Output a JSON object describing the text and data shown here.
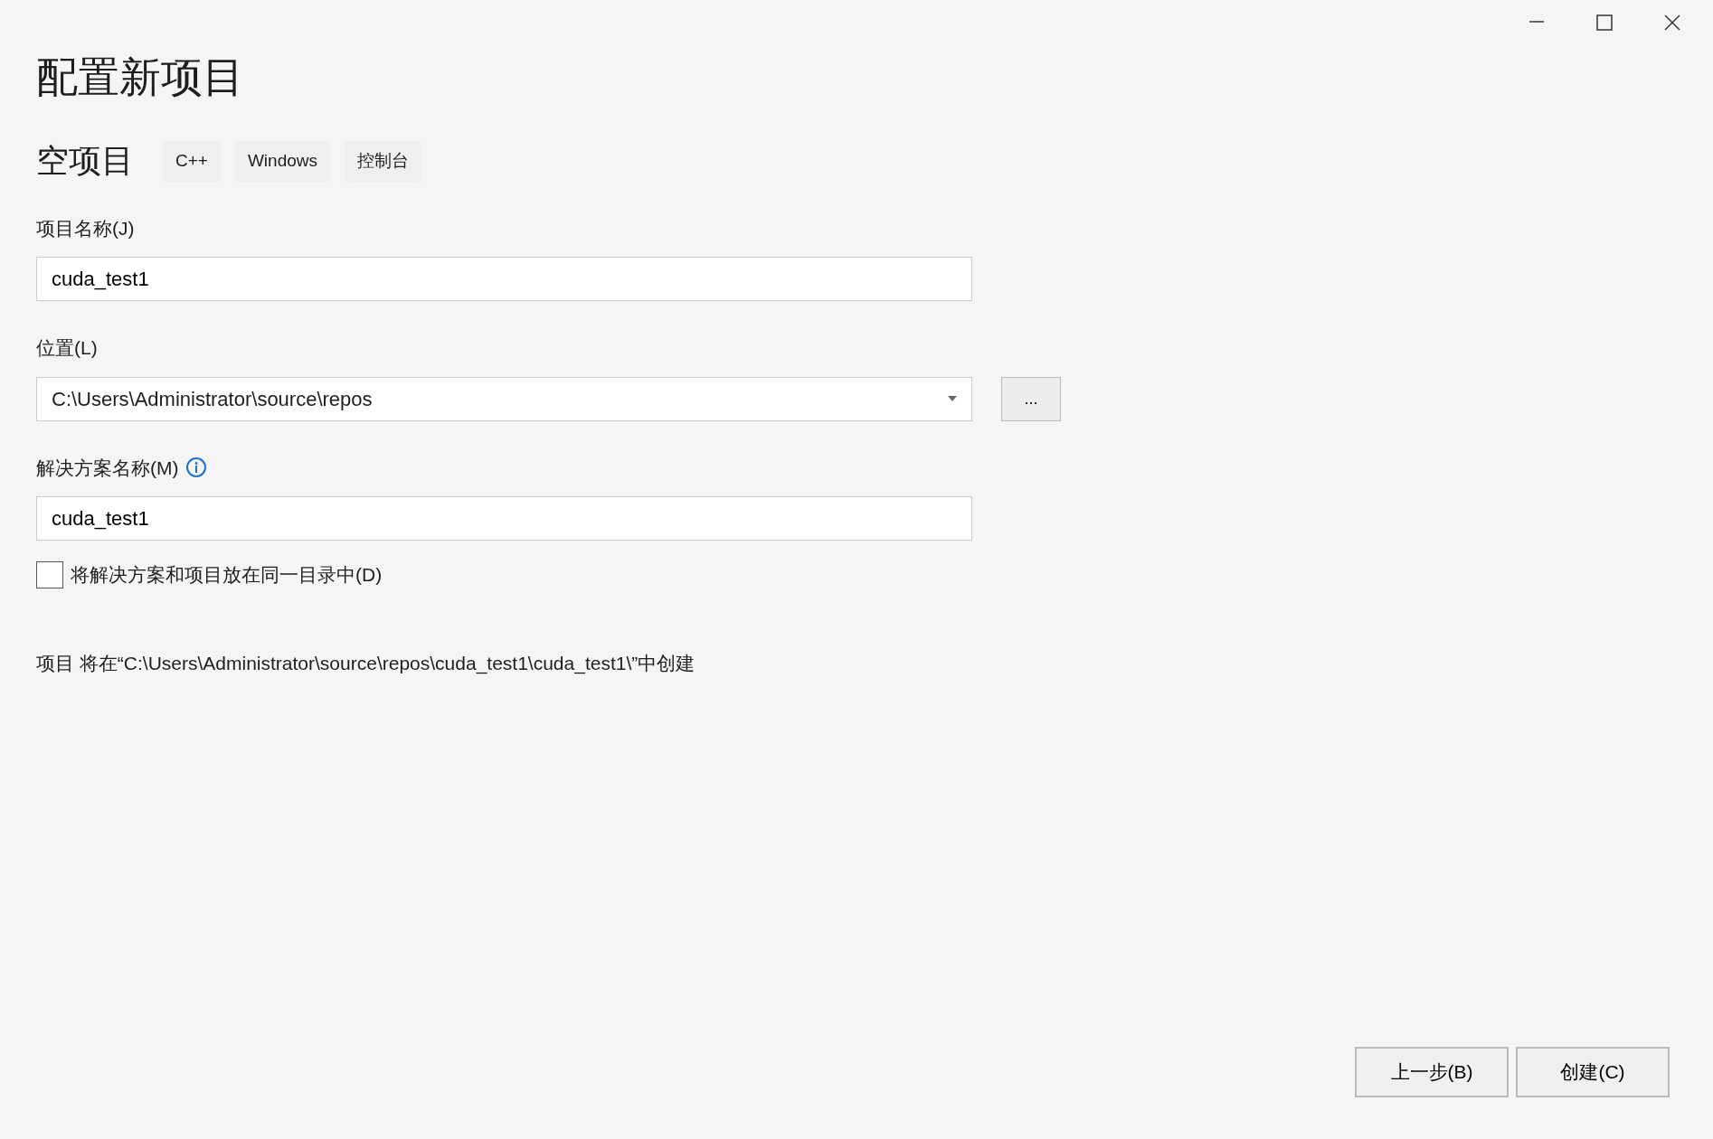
{
  "window": {
    "title": "配置新项目"
  },
  "template": {
    "name": "空项目",
    "tags": [
      "C++",
      "Windows",
      "控制台"
    ]
  },
  "fields": [
    {
      "kind": "text",
      "label": "项目名称(J)",
      "value": "cuda_test1"
    },
    {
      "kind": "combo",
      "label": "位置(L)",
      "value": "C:\\Users\\Administrator\\source\\repos",
      "browse": "..."
    },
    {
      "kind": "text",
      "label": "解决方案名称(M)",
      "value": "cuda_test1",
      "info": true
    }
  ],
  "same_dir": {
    "label": "将解决方案和项目放在同一目录中(D)",
    "checked": false
  },
  "summary": "项目 将在“C:\\Users\\Administrator\\source\\repos\\cuda_test1\\cuda_test1\\”中创建",
  "buttons": [
    "上一步(B)",
    "创建(C)"
  ]
}
